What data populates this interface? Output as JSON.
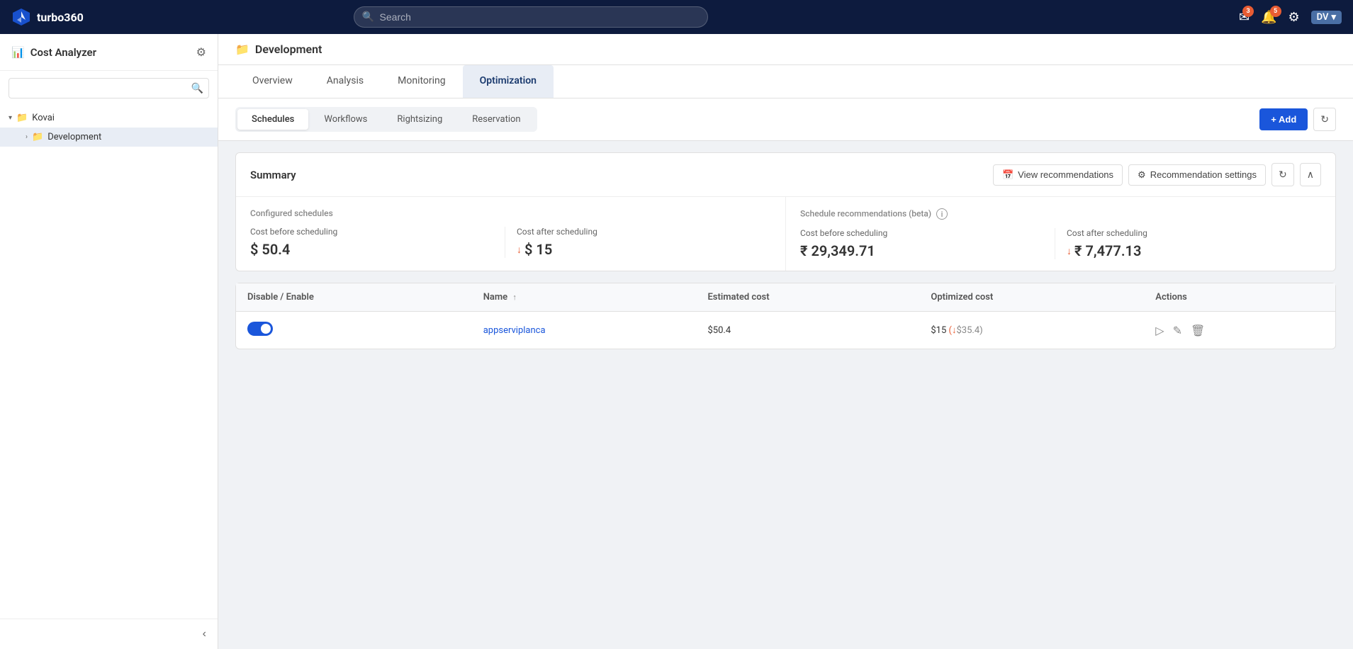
{
  "app": {
    "name": "turbo360",
    "logo_text": "turbo360"
  },
  "topnav": {
    "search_placeholder": "Search",
    "notifications_badge": "3",
    "alerts_badge": "5",
    "user_initials": "DV",
    "user_chevron": "▾"
  },
  "sidebar": {
    "title": "Cost Analyzer",
    "search_placeholder": "",
    "tree": [
      {
        "label": "Kovai",
        "type": "group",
        "expanded": true,
        "indent": 0
      },
      {
        "label": "Development",
        "type": "item",
        "active": true,
        "indent": 1
      }
    ],
    "collapse_icon": "‹"
  },
  "page": {
    "breadcrumb": "Development",
    "tabs": [
      {
        "label": "Overview",
        "active": false
      },
      {
        "label": "Analysis",
        "active": false
      },
      {
        "label": "Monitoring",
        "active": false
      },
      {
        "label": "Optimization",
        "active": true
      }
    ],
    "sub_tabs": [
      {
        "label": "Schedules",
        "active": true
      },
      {
        "label": "Workflows",
        "active": false
      },
      {
        "label": "Rightsizing",
        "active": false
      },
      {
        "label": "Reservation",
        "active": false
      }
    ],
    "add_button": "+ Add"
  },
  "summary": {
    "title": "Summary",
    "view_recommendations_btn": "View recommendations",
    "recommendation_settings_btn": "Recommendation settings",
    "configured_section_title": "Configured schedules",
    "recommendations_section_title": "Schedule recommendations (beta)",
    "metrics": {
      "configured": {
        "before_label": "Cost before scheduling",
        "before_value": "$ 50.4",
        "after_label": "Cost after scheduling",
        "after_arrow": "↓",
        "after_value": "$ 15"
      },
      "recommended": {
        "before_label": "Cost before scheduling",
        "before_value": "₹ 29,349.71",
        "after_label": "Cost after scheduling",
        "after_arrow": "↓",
        "after_value": "₹ 7,477.13"
      }
    }
  },
  "table": {
    "columns": [
      {
        "label": "Disable / Enable"
      },
      {
        "label": "Name",
        "sortable": true,
        "sort_icon": "↑"
      },
      {
        "label": "Estimated cost"
      },
      {
        "label": "Optimized cost"
      },
      {
        "label": "Actions"
      }
    ],
    "rows": [
      {
        "enabled": true,
        "name": "appserviplanca",
        "estimated_cost": "$50.4",
        "optimized_cost": "$15",
        "savings": "(↓$35.4)"
      }
    ]
  }
}
